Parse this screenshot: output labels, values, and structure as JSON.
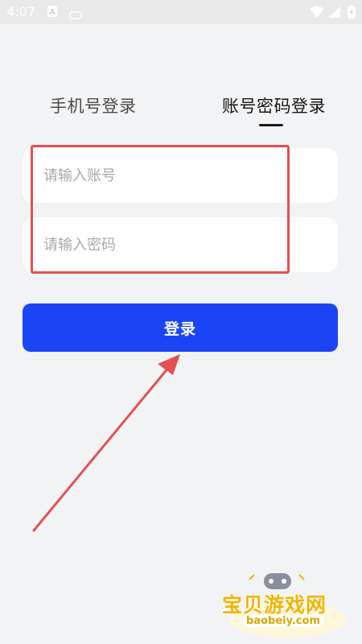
{
  "status_bar": {
    "time": "4:07",
    "icons": [
      "notification-a-icon",
      "notification-pill-icon",
      "wifi-icon",
      "signal-icon",
      "battery-icon"
    ]
  },
  "tabs": [
    {
      "label": "手机号登录",
      "active": false
    },
    {
      "label": "账号密码登录",
      "active": true
    }
  ],
  "form": {
    "account_placeholder": "请输入账号",
    "password_placeholder": "请输入密码",
    "login_label": "登录"
  },
  "watermark": {
    "title": "宝贝游戏网",
    "url": "baobeiy.com"
  },
  "colors": {
    "background": "#f2f3f5",
    "primary": "#1a44f4",
    "annotation": "#e2514f"
  }
}
